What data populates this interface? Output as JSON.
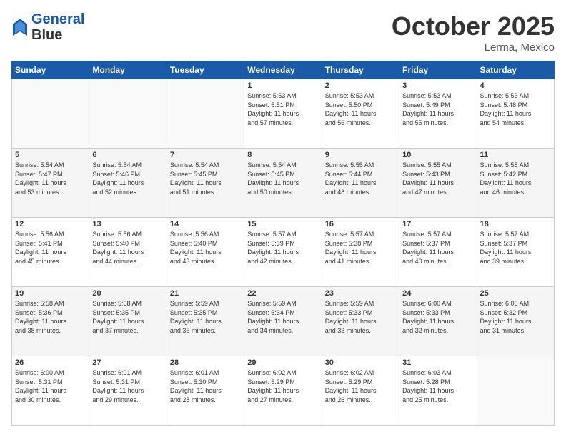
{
  "header": {
    "logo_line1": "General",
    "logo_line2": "Blue",
    "month": "October 2025",
    "location": "Lerma, Mexico"
  },
  "days_of_week": [
    "Sunday",
    "Monday",
    "Tuesday",
    "Wednesday",
    "Thursday",
    "Friday",
    "Saturday"
  ],
  "weeks": [
    [
      {
        "day": "",
        "info": ""
      },
      {
        "day": "",
        "info": ""
      },
      {
        "day": "",
        "info": ""
      },
      {
        "day": "1",
        "info": "Sunrise: 5:53 AM\nSunset: 5:51 PM\nDaylight: 11 hours\nand 57 minutes."
      },
      {
        "day": "2",
        "info": "Sunrise: 5:53 AM\nSunset: 5:50 PM\nDaylight: 11 hours\nand 56 minutes."
      },
      {
        "day": "3",
        "info": "Sunrise: 5:53 AM\nSunset: 5:49 PM\nDaylight: 11 hours\nand 55 minutes."
      },
      {
        "day": "4",
        "info": "Sunrise: 5:53 AM\nSunset: 5:48 PM\nDaylight: 11 hours\nand 54 minutes."
      }
    ],
    [
      {
        "day": "5",
        "info": "Sunrise: 5:54 AM\nSunset: 5:47 PM\nDaylight: 11 hours\nand 53 minutes."
      },
      {
        "day": "6",
        "info": "Sunrise: 5:54 AM\nSunset: 5:46 PM\nDaylight: 11 hours\nand 52 minutes."
      },
      {
        "day": "7",
        "info": "Sunrise: 5:54 AM\nSunset: 5:45 PM\nDaylight: 11 hours\nand 51 minutes."
      },
      {
        "day": "8",
        "info": "Sunrise: 5:54 AM\nSunset: 5:45 PM\nDaylight: 11 hours\nand 50 minutes."
      },
      {
        "day": "9",
        "info": "Sunrise: 5:55 AM\nSunset: 5:44 PM\nDaylight: 11 hours\nand 48 minutes."
      },
      {
        "day": "10",
        "info": "Sunrise: 5:55 AM\nSunset: 5:43 PM\nDaylight: 11 hours\nand 47 minutes."
      },
      {
        "day": "11",
        "info": "Sunrise: 5:55 AM\nSunset: 5:42 PM\nDaylight: 11 hours\nand 46 minutes."
      }
    ],
    [
      {
        "day": "12",
        "info": "Sunrise: 5:56 AM\nSunset: 5:41 PM\nDaylight: 11 hours\nand 45 minutes."
      },
      {
        "day": "13",
        "info": "Sunrise: 5:56 AM\nSunset: 5:40 PM\nDaylight: 11 hours\nand 44 minutes."
      },
      {
        "day": "14",
        "info": "Sunrise: 5:56 AM\nSunset: 5:40 PM\nDaylight: 11 hours\nand 43 minutes."
      },
      {
        "day": "15",
        "info": "Sunrise: 5:57 AM\nSunset: 5:39 PM\nDaylight: 11 hours\nand 42 minutes."
      },
      {
        "day": "16",
        "info": "Sunrise: 5:57 AM\nSunset: 5:38 PM\nDaylight: 11 hours\nand 41 minutes."
      },
      {
        "day": "17",
        "info": "Sunrise: 5:57 AM\nSunset: 5:37 PM\nDaylight: 11 hours\nand 40 minutes."
      },
      {
        "day": "18",
        "info": "Sunrise: 5:57 AM\nSunset: 5:37 PM\nDaylight: 11 hours\nand 39 minutes."
      }
    ],
    [
      {
        "day": "19",
        "info": "Sunrise: 5:58 AM\nSunset: 5:36 PM\nDaylight: 11 hours\nand 38 minutes."
      },
      {
        "day": "20",
        "info": "Sunrise: 5:58 AM\nSunset: 5:35 PM\nDaylight: 11 hours\nand 37 minutes."
      },
      {
        "day": "21",
        "info": "Sunrise: 5:59 AM\nSunset: 5:35 PM\nDaylight: 11 hours\nand 35 minutes."
      },
      {
        "day": "22",
        "info": "Sunrise: 5:59 AM\nSunset: 5:34 PM\nDaylight: 11 hours\nand 34 minutes."
      },
      {
        "day": "23",
        "info": "Sunrise: 5:59 AM\nSunset: 5:33 PM\nDaylight: 11 hours\nand 33 minutes."
      },
      {
        "day": "24",
        "info": "Sunrise: 6:00 AM\nSunset: 5:33 PM\nDaylight: 11 hours\nand 32 minutes."
      },
      {
        "day": "25",
        "info": "Sunrise: 6:00 AM\nSunset: 5:32 PM\nDaylight: 11 hours\nand 31 minutes."
      }
    ],
    [
      {
        "day": "26",
        "info": "Sunrise: 6:00 AM\nSunset: 5:31 PM\nDaylight: 11 hours\nand 30 minutes."
      },
      {
        "day": "27",
        "info": "Sunrise: 6:01 AM\nSunset: 5:31 PM\nDaylight: 11 hours\nand 29 minutes."
      },
      {
        "day": "28",
        "info": "Sunrise: 6:01 AM\nSunset: 5:30 PM\nDaylight: 11 hours\nand 28 minutes."
      },
      {
        "day": "29",
        "info": "Sunrise: 6:02 AM\nSunset: 5:29 PM\nDaylight: 11 hours\nand 27 minutes."
      },
      {
        "day": "30",
        "info": "Sunrise: 6:02 AM\nSunset: 5:29 PM\nDaylight: 11 hours\nand 26 minutes."
      },
      {
        "day": "31",
        "info": "Sunrise: 6:03 AM\nSunset: 5:28 PM\nDaylight: 11 hours\nand 25 minutes."
      },
      {
        "day": "",
        "info": ""
      }
    ]
  ]
}
